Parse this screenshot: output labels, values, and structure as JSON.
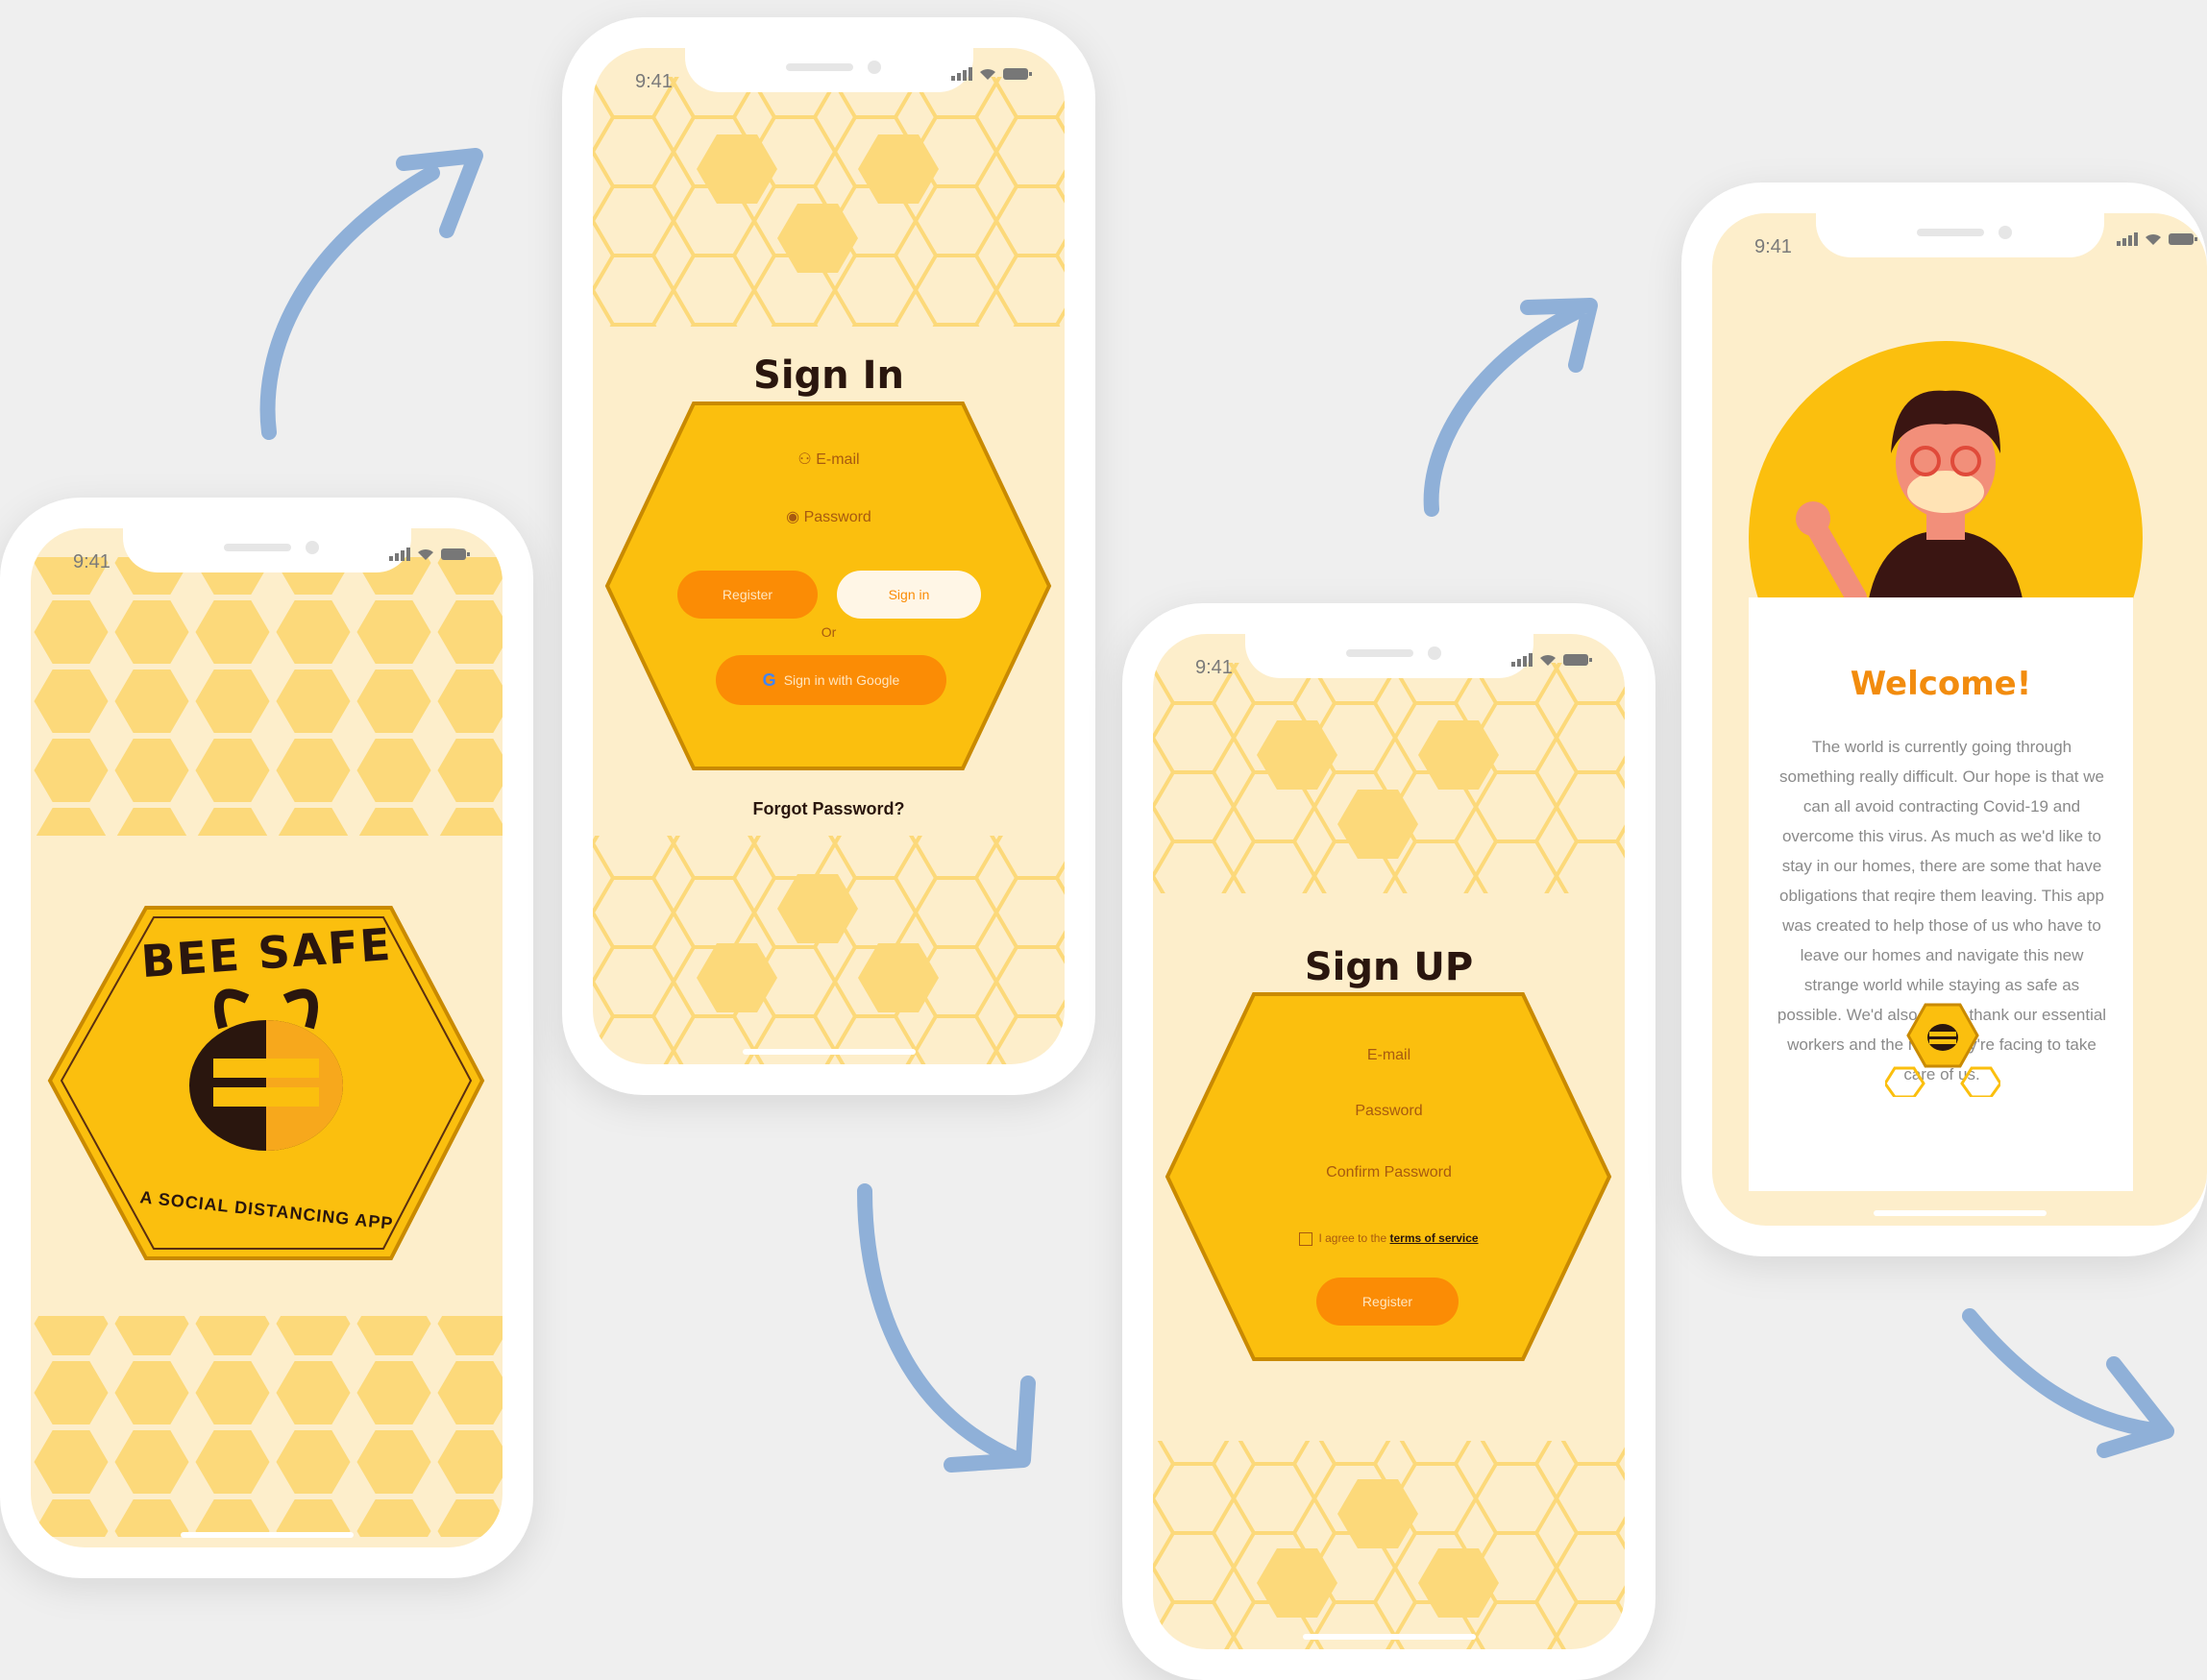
{
  "status_bar": {
    "time": "9:41"
  },
  "screen1_splash": {
    "logo_title": "BEE SAFE",
    "logo_tagline": "A SOCIAL DISTANCING APP"
  },
  "screen2_signin": {
    "title": "Sign In",
    "email_placeholder": "E-mail",
    "password_placeholder": "Password",
    "register_label": "Register",
    "signin_label": "Sign in",
    "or_label": "Or",
    "google_label": "Sign in with Google",
    "forgot_label": "Forgot Password?"
  },
  "screen3_signup": {
    "title": "Sign UP",
    "email_placeholder": "E-mail",
    "password_placeholder": "Password",
    "confirm_placeholder": "Confirm Password",
    "terms_prefix": "I agree to the ",
    "terms_link": "terms of service",
    "register_label": "Register"
  },
  "screen4_welcome": {
    "title": "Welcome!",
    "body": "The world is currently going through something really difficult. Our hope is that we can all avoid contracting Covid-19 and overcome this virus. As much as we'd like to stay in our homes, there are some that have obligations that reqire them leaving. This app was created to help those of us who have to leave our homes and navigate this new strange world while staying as safe as possible. We'd also like to thank our essential workers and the risks they're facing to take care of us."
  },
  "colors": {
    "background": "#efefef",
    "screen_bg": "#fdeecb",
    "honey": "#fbbf0e",
    "honey_light": "#fcdc85",
    "orange_button": "#fb8c05",
    "dark_brown": "#2a160e",
    "arrow_blue": "#8fb0d8"
  }
}
